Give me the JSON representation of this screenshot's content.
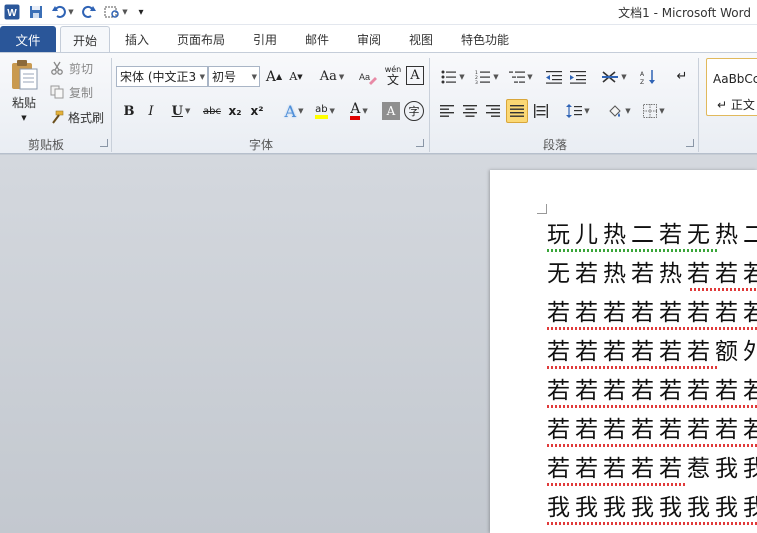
{
  "window": {
    "title": "文档1 - Microsoft Word"
  },
  "quick_access": {
    "icons": [
      "word-app-icon",
      "save-icon",
      "undo-icon",
      "redo-icon",
      "print-preview-icon",
      "customize-qa-icon"
    ]
  },
  "tabs": {
    "file": "文件",
    "items": [
      "开始",
      "插入",
      "页面布局",
      "引用",
      "邮件",
      "审阅",
      "视图",
      "特色功能"
    ],
    "active": "开始"
  },
  "clipboard": {
    "paste": "粘贴",
    "cut": "剪切",
    "copy": "复制",
    "format_painter": "格式刷",
    "label": "剪贴板"
  },
  "font": {
    "name": "宋体 (中文正3",
    "size": "初号",
    "grow": "A",
    "shrink": "A",
    "change_case": "Aa",
    "bold": "B",
    "italic": "I",
    "underline": "U",
    "strike": "abc",
    "subscript": "x₂",
    "superscript": "x²",
    "text_effect": "A",
    "highlight": "ab",
    "font_color": "A",
    "char_shading": "A",
    "enclose": "字",
    "phonetic": "文",
    "phonetic_top": "wén",
    "border": "A",
    "label": "字体",
    "colors": {
      "highlight": "#ffff00",
      "font_color": "#e00000"
    }
  },
  "paragraph": {
    "label": "段落"
  },
  "styles": {
    "sample": "AaBbCcDc",
    "name": "↵ 正文"
  },
  "document": {
    "lines": [
      "玩儿热二若无热二",
      "无若热若热若若若",
      "若若若若若若若若",
      "若若若若若若额外",
      "若若若若若若若若",
      "若若若若若若若若",
      "若若若若若惹我我",
      "我我我我我我我我"
    ]
  }
}
